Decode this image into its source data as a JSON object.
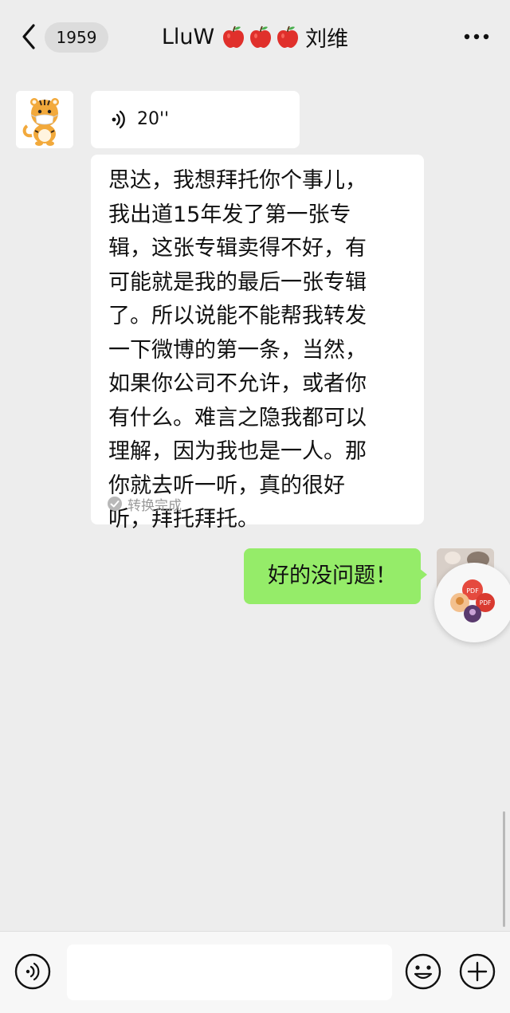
{
  "header": {
    "unread_count": "1959",
    "title_prefix": "LluW",
    "title_suffix": "刘维",
    "title_emojis": [
      "apple",
      "apple",
      "apple"
    ]
  },
  "messages": {
    "voice": {
      "duration": "20''"
    },
    "transcript": {
      "text": "思达，我想拜托你个事儿，\n我出道15年发了第一张专\n辑，这张专辑卖得不好，有\n可能就是我的最后一张专辑\n了。所以说能不能帮我转发\n一下微博的第一条，当然，\n如果你公司不允许，或者你\n有什么。难言之隐我都可以\n理解，因为我也是一人。那\n你就去听一听，真的很好\n听，拜托拜托。",
      "status": "转换完成"
    },
    "reply": {
      "text": "好的没问题！"
    }
  },
  "input_bar": {
    "placeholder": ""
  },
  "colors": {
    "background": "#ededed",
    "bubble_received": "#ffffff",
    "bubble_sent": "#95ec69",
    "apple_red": "#e0302b"
  },
  "icons": [
    "back-arrow-icon",
    "more-icon",
    "voice-wave-icon",
    "check-circle-icon",
    "voice-input-icon",
    "emoji-icon",
    "plus-icon",
    "apple-icon"
  ]
}
